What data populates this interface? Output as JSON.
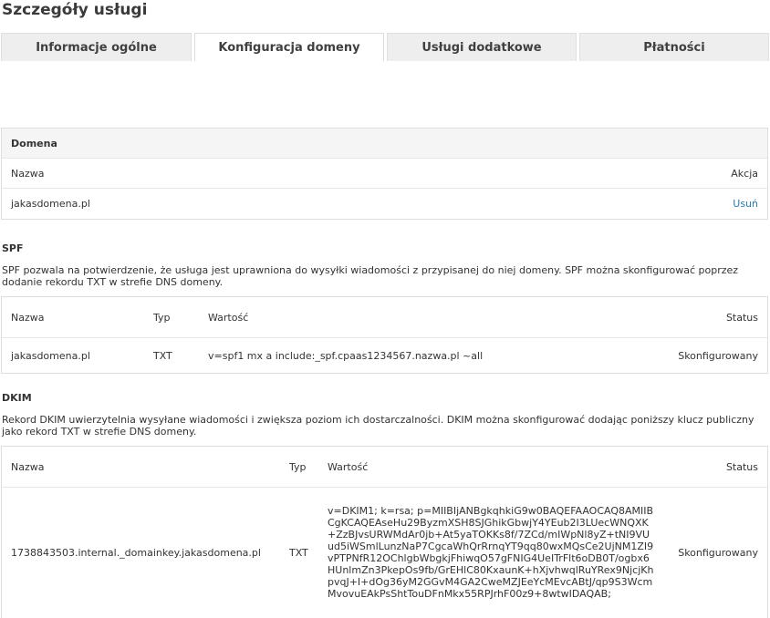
{
  "page": {
    "title": "Szczegóły usługi"
  },
  "tabs": [
    {
      "label": "Informacje ogólne"
    },
    {
      "label": "Konfiguracja domeny"
    },
    {
      "label": "Usługi dodatkowe"
    },
    {
      "label": "Płatności"
    }
  ],
  "domain": {
    "header": "Domena",
    "col_name": "Nazwa",
    "col_action": "Akcja",
    "rows": [
      {
        "name": "jakasdomena.pl",
        "action": "Usuń"
      }
    ]
  },
  "spf": {
    "title": "SPF",
    "description": "SPF pozwala na potwierdzenie, że usługa jest uprawniona do wysyłki wiadomości z przypisanej do niej domeny. SPF można skonfigurować poprzez dodanie rekordu TXT w strefie DNS domeny.",
    "columns": {
      "name": "Nazwa",
      "type": "Typ",
      "value": "Wartość",
      "status": "Status"
    },
    "rows": [
      {
        "name": "jakasdomena.pl",
        "type": "TXT",
        "value": "v=spf1 mx a include:_spf.cpaas1234567.nazwa.pl ~all",
        "status": "Skonfigurowany"
      }
    ]
  },
  "dkim": {
    "title": "DKIM",
    "description": "Rekord DKIM uwierzytelnia wysyłane wiadomości i zwiększa poziom ich dostarczalności. DKIM można skonfigurować dodając poniższy klucz publiczny jako rekord TXT w strefie DNS domeny.",
    "columns": {
      "name": "Nazwa",
      "type": "Typ",
      "value": "Wartość",
      "status": "Status"
    },
    "rows": [
      {
        "name": "1738843503.internal._domainkey.jakasdomena.pl",
        "type": "TXT",
        "value": "v=DKIM1; k=rsa; p=MIIBIjANBgkqhkiG9w0BAQEFAAOCAQ8AMIIBCgKCAQEAseHu29ByzmXSH8SJGhikGbwjY4YEub2I3LUecWNQXK+ZzBJvsURWMdAr0jb+At5yaTOKKs8f/7ZCd/mIWpNl8yZ+tNI9VUud5iWSmlLunzNaP7CgcaWhQrRrnqYT9qq80wxMQsCe2UjNM1ZI9vPTPNfR12OChlgbWbgkjFhiwqO57gFNIG4UeITrFlt6oDB0T/ogbx6HUnlmZn3PkepOs9fb/GrEHlC80KxaunK+hXjvhwqlRuYRex9NjcjKhpvqJ+I+dOg36yM2GGvM4GA2CweMZJEeYcMEvcABtJ/qp9S3WcmMvovuEAkPsShtTouDFnMkx55RPJrhF00z9+8wtwIDAQAB;",
        "status": "Skonfigurowany"
      }
    ]
  }
}
